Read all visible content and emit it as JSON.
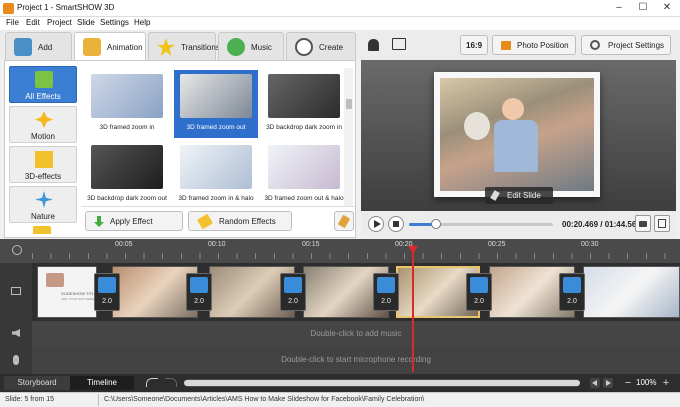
{
  "window": {
    "title": "Project 1 - SmartSHOW 3D"
  },
  "menu": [
    "File",
    "Edit",
    "Project",
    "Slide",
    "Settings",
    "Help"
  ],
  "tabs": [
    {
      "label": "Add"
    },
    {
      "label": "Animation"
    },
    {
      "label": "Transitions"
    },
    {
      "label": "Music"
    },
    {
      "label": "Create"
    }
  ],
  "right_toolbar": {
    "aspect": "16:9",
    "photo_position": "Photo Position",
    "project_settings": "Project Settings"
  },
  "categories": [
    {
      "label": "All Effects"
    },
    {
      "label": "Motion"
    },
    {
      "label": "3D-effects"
    },
    {
      "label": "Nature"
    }
  ],
  "effects": [
    {
      "label": "3D framed zoom in"
    },
    {
      "label": "3D framed zoom out"
    },
    {
      "label": "3D backdrop dark zoom in"
    },
    {
      "label": "3D backdrop dark zoom out"
    },
    {
      "label": "3D framed zoom in & halo"
    },
    {
      "label": "3D framed zoom out & halo"
    }
  ],
  "panel_buttons": {
    "apply": "Apply Effect",
    "random": "Random Effects"
  },
  "preview": {
    "edit_slide": "Edit Slide",
    "time": "00:20.469 / 01:44.564",
    "progress": 0.19
  },
  "ruler": [
    "00:05",
    "00:10",
    "00:15",
    "00:20",
    "00:25",
    "00:30"
  ],
  "slide_thumb_text": {
    "title": "SLIDESHOW TITLE",
    "sub": "ADD YOUR TEXT HERE"
  },
  "transitions": [
    "2.0",
    "2.0",
    "2.0",
    "2.0",
    "2.0",
    "2.0"
  ],
  "tracks": {
    "audio_hint": "Double-click to add music",
    "mic_hint": "Double-click to start microphone recording"
  },
  "bottom": {
    "storyboard": "Storyboard",
    "timeline": "Timeline",
    "zoom": "100%"
  },
  "status": {
    "slide": "Slide: 5 from 15",
    "path": "C:\\Users\\Someone\\Documents\\Articles\\AMS How to Make Slideshow for Facebook\\Family Celebration\\"
  },
  "colors": {
    "accent": "#3b7fd4",
    "playhead": "#d92a2a"
  }
}
